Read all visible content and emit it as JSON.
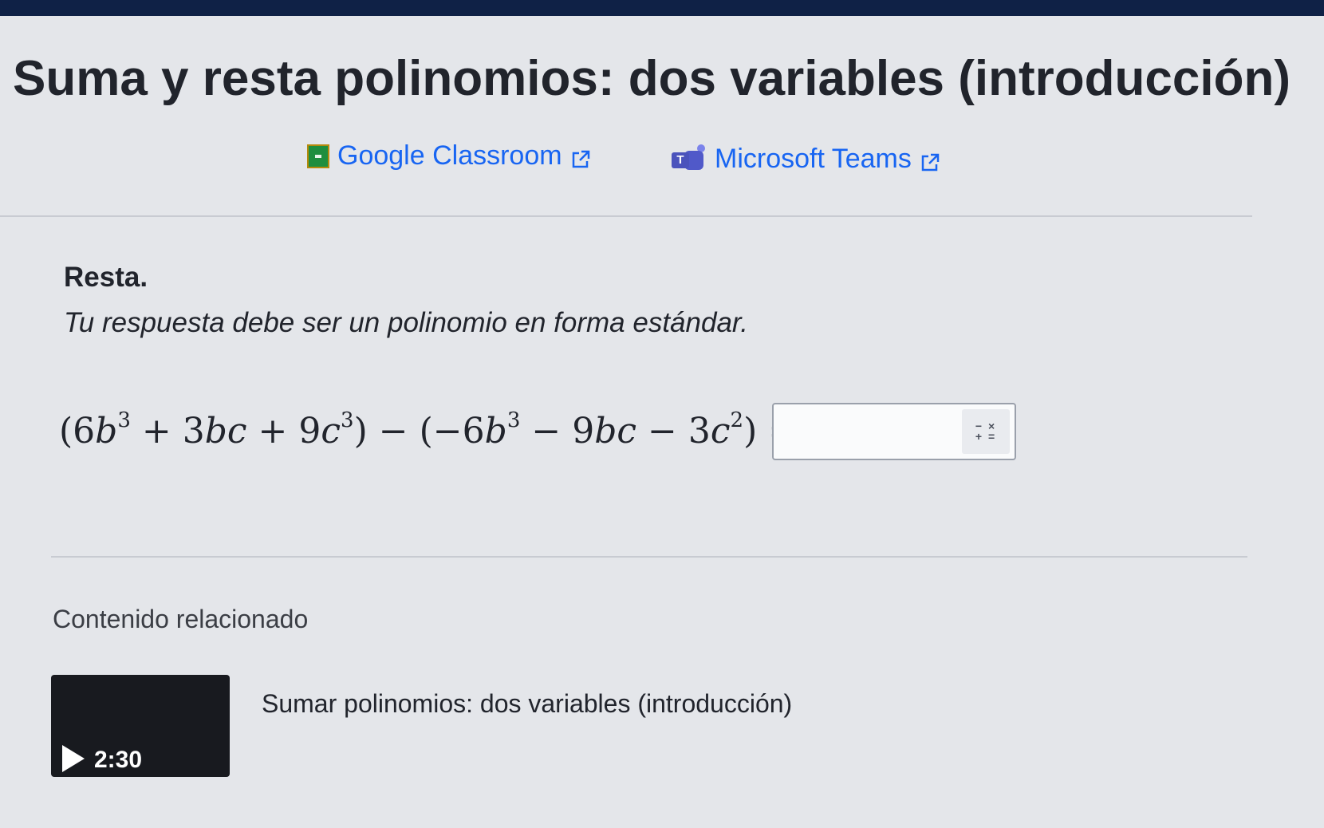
{
  "page": {
    "title": "Suma y resta polinomios: dos variables (introducción)"
  },
  "share": {
    "google_classroom": {
      "label": "Google Classroom",
      "icon": "google-classroom-icon"
    },
    "microsoft_teams": {
      "label": "Microsoft Teams",
      "icon": "microsoft-teams-icon",
      "icon_letter": "T"
    },
    "external_icon": "external-link-icon"
  },
  "problem": {
    "title": "Resta.",
    "instruction": "Tu respuesta debe ser un polinomio en forma estándar.",
    "equation": {
      "open1": "(6",
      "v1": "b",
      "e1": "3",
      "t2": " + 3",
      "v2": "bc",
      "t3": " + 9",
      "v3": "c",
      "e3": "3",
      "mid": ") − (−6",
      "v4": "b",
      "e4": "3",
      "t5": " − 9",
      "v5": "bc",
      "t6": " − 3",
      "v6": "c",
      "e6": "2",
      "close": ") ="
    },
    "answer": {
      "value": "",
      "keyboard_icon": "math-keyboard-icon",
      "keyboard_glyph_top": "− ×",
      "keyboard_glyph_bottom": "+ ="
    }
  },
  "related": {
    "heading": "Contenido relacionado",
    "items": [
      {
        "title": "Sumar polinomios: dos variables (introducción)",
        "duration": "2:30",
        "icon": "play-icon"
      }
    ]
  },
  "colors": {
    "topbar": "#0f2146",
    "link": "#1865f2",
    "background": "#e4e6ea",
    "text": "#21242c"
  }
}
